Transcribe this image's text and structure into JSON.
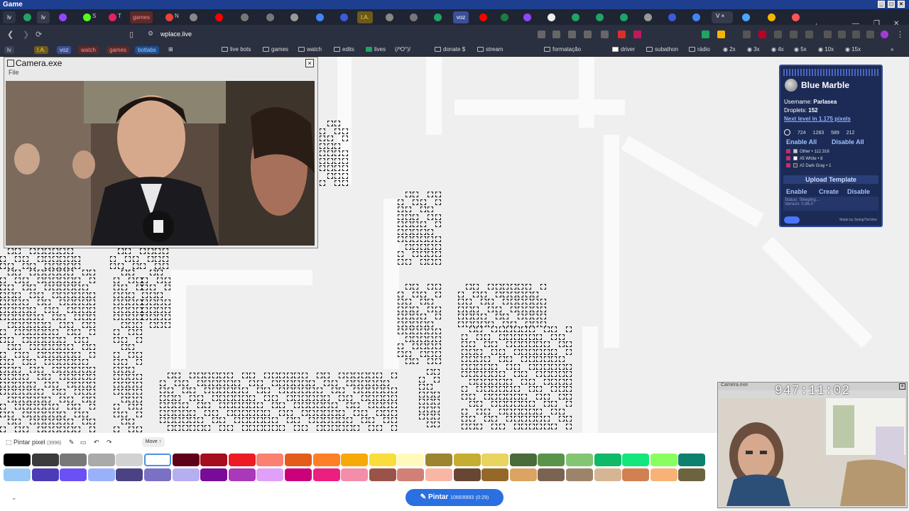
{
  "window": {
    "title": "Game"
  },
  "tabs": [
    {
      "label": "lv"
    },
    {
      "label": "S"
    },
    {
      "label": "T"
    },
    {
      "label": "games"
    },
    {
      "label": "N"
    },
    {
      "label": "I.A."
    },
    {
      "label": "voz"
    }
  ],
  "address": {
    "url": "wplace.live"
  },
  "bookmarks": [
    {
      "label": "lv"
    },
    {
      "label": "I.A."
    },
    {
      "label": "voz"
    },
    {
      "label": "watch"
    },
    {
      "label": "games"
    },
    {
      "label": "botlabs"
    },
    {
      "label": "live bots"
    },
    {
      "label": "games"
    },
    {
      "label": "watch"
    },
    {
      "label": "edits"
    },
    {
      "label": "lives"
    },
    {
      "label": "(/ºO°)/"
    },
    {
      "label": "donate $"
    },
    {
      "label": "stream"
    },
    {
      "label": "formatação"
    },
    {
      "label": "driver"
    },
    {
      "label": "subathon"
    },
    {
      "label": "rádio"
    },
    {
      "label": "2x"
    },
    {
      "label": "3x"
    },
    {
      "label": "4x"
    },
    {
      "label": "5x"
    },
    {
      "label": "10x"
    },
    {
      "label": "15x"
    }
  ],
  "camera": {
    "title": "Camera.exe",
    "menu": "File",
    "close": "×"
  },
  "blue_marble": {
    "title": "Blue Marble",
    "username_label": "Username:",
    "username": "Parlasea",
    "droplets_label": "Droplets:",
    "droplets": "152",
    "next_level": "Next level in 1.175 pixels",
    "coords": [
      "724",
      "1283",
      "589",
      "212"
    ],
    "enable_all": "Enable All",
    "disable_all": "Disable All",
    "templates": [
      {
        "label": "Other",
        "value": "112.316",
        "color": "#cccccc"
      },
      {
        "label": "#5 White",
        "value": "8",
        "color": "#ffffff"
      },
      {
        "label": "#2 Dark Gray",
        "value": "1",
        "color": "#3c3c3c"
      }
    ],
    "upload_template": "Upload Template",
    "enable": "Enable",
    "create": "Create",
    "disable": "Disable",
    "status": "Status: Sleeping...",
    "version": "Version: 0.86.0",
    "made_by": "Made by SwingTheVine"
  },
  "toolbar": {
    "pintar_pixel": "Pintar pixel",
    "pixel_count": "(3998)",
    "move_label": "Move"
  },
  "palette": {
    "row1": [
      "#000000",
      "#3c3c3c",
      "#787878",
      "#aaaaaa",
      "#d2d2d2",
      "#ffffff",
      "#600018",
      "#a50e1e",
      "#ed1c24",
      "#fa8072",
      "#e45c1a",
      "#ff7f27",
      "#f6aa09",
      "#f9dd3b",
      "#fffabc",
      "#9c8431",
      "#c5ad31",
      "#e8d45f",
      "#4a6b3a",
      "#5a944a",
      "#84c573",
      "#0eb968",
      "#13e67b",
      "#87ff5e",
      "#0c816e"
    ],
    "row2": [
      "#99c8f7",
      "#4b3cb5",
      "#6b50f6",
      "#99b1fb",
      "#4a4284",
      "#7a71c4",
      "#b5aef1",
      "#780c99",
      "#aa38b9",
      "#e09ff9",
      "#cb007a",
      "#ec1f80",
      "#f38da9",
      "#9b5249",
      "#d18078",
      "#fab6a4",
      "#684634",
      "#95682a",
      "#dba463",
      "#7b6352",
      "#9c846b",
      "#d6b594",
      "#d18051",
      "#f8b277",
      "#6d643f"
    ]
  },
  "pintar": {
    "label": "Pintar",
    "count": "1066/8993",
    "time": "(0:29)"
  },
  "webcam": {
    "title": "Camera.exe",
    "timer": "947:11:02"
  }
}
